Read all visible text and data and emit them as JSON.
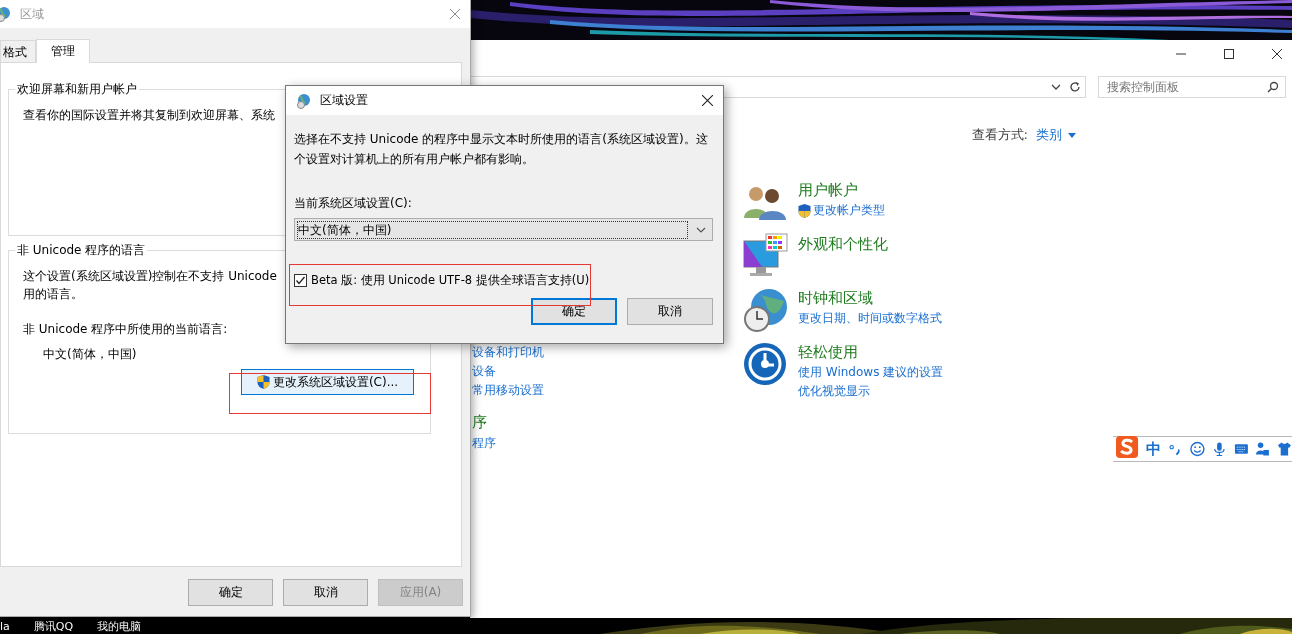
{
  "region_window": {
    "title": "区域",
    "tabs": [
      {
        "label": "格式",
        "selected": false
      },
      {
        "label": "管理",
        "selected": true
      }
    ],
    "welcome_group": {
      "title": "欢迎屏幕和新用户帐户",
      "text": "查看你的国际设置并将其复制到欢迎屏幕、系统"
    },
    "non_unicode_group": {
      "title": "非 Unicode 程序的语言",
      "text_lines": [
        "这个设置(系统区域设置)控制在不支持 Unicode",
        "用的语言。"
      ],
      "current_label": "非 Unicode 程序中所使用的当前语言:",
      "current_value": "中文(简体，中国)",
      "change_button": "更改系统区域设置(C)..."
    },
    "buttons": [
      {
        "label": "确定",
        "disabled": false
      },
      {
        "label": "取消",
        "disabled": false
      },
      {
        "label": "应用(A)",
        "disabled": true
      }
    ]
  },
  "locale_dialog": {
    "title": "区域设置",
    "description": "选择在不支持 Unicode 的程序中显示文本时所使用的语言(系统区域设置)。这个设置对计算机上的所有用户帐户都有影响。",
    "current_label": "当前系统区域设置(C):",
    "select_value": "中文(简体，中国)",
    "beta_option": {
      "label": "Beta 版: 使用 Unicode UTF-8 提供全球语言支持(U)",
      "checked": true
    },
    "buttons": [
      {
        "label": "确定",
        "selected": true
      },
      {
        "label": "取消",
        "selected": false
      }
    ]
  },
  "control_panel": {
    "search": {
      "placeholder": "搜索控制面板"
    },
    "view_by": {
      "label": "查看方式:",
      "value": "类别"
    },
    "left_items": [
      {
        "kind": "link",
        "label": "设备和打印机"
      },
      {
        "kind": "link",
        "label": "设备"
      },
      {
        "kind": "link",
        "label": "常用移动设置"
      },
      {
        "kind": "heading",
        "label": "序"
      },
      {
        "kind": "link",
        "label": "程序"
      }
    ],
    "categories": [
      {
        "kind": "users",
        "title": "用户帐户",
        "links": [
          {
            "label": "更改帐户类型",
            "shield": true
          }
        ]
      },
      {
        "kind": "appearance",
        "title": "外观和个性化"
      },
      {
        "kind": "clock",
        "title": "时钟和区域",
        "links": [
          {
            "label": "更改日期、时间或数字格式",
            "shield": false
          }
        ]
      },
      {
        "kind": "ease",
        "title": "轻松使用",
        "links": [
          {
            "label": "使用 Windows 建议的设置",
            "shield": false
          },
          {
            "label": "优化视觉显示",
            "shield": false
          }
        ]
      }
    ]
  },
  "ime_toolbar": {
    "mode": "中"
  },
  "desktop_icons": [
    {
      "label": "la"
    },
    {
      "label": "腾讯QQ"
    },
    {
      "label": "我的电脑"
    }
  ]
}
